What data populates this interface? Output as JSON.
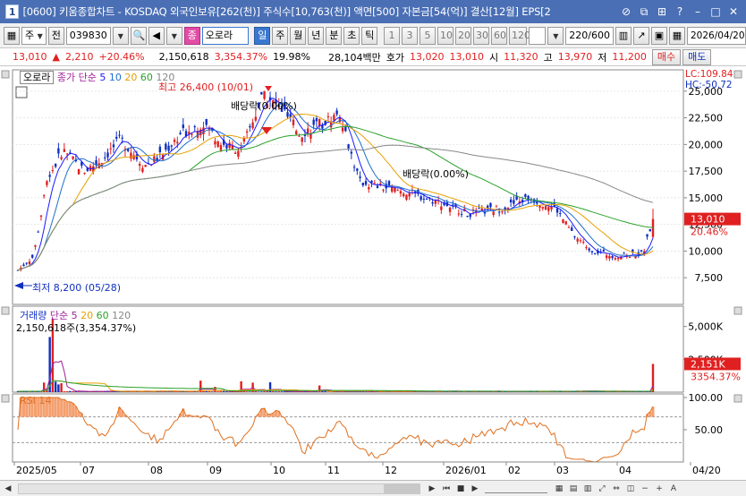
{
  "window": {
    "number": "1",
    "title": "[0600] 키움종합차트 - KOSDAQ 외국인보유[262(천)] 주식수[10,763(천)] 액면[500] 자본금[54(억)] 결산[12월] EPS[2"
  },
  "toolbar": {
    "type_select": "주",
    "scope": "전",
    "code": "039830",
    "search_icon": "magnifier-icon",
    "name_badge": "종",
    "stock_name": "오로라",
    "period_tabs": [
      "일",
      "주",
      "월",
      "년",
      "분",
      "초",
      "틱"
    ],
    "active_period": "일",
    "intervals": [
      "1",
      "3",
      "5",
      "10",
      "20",
      "30",
      "60",
      "120"
    ],
    "count": "220",
    "total": "/600",
    "date": "2026/04/20"
  },
  "quote": {
    "price": "13,010",
    "change": "2,210",
    "change_pct": "+20.46%",
    "volume": "2,150,618",
    "volume_pct": "3,354.37%",
    "turnover": "19.98%",
    "amount": "28,104백만",
    "bid_label": "호가",
    "ask": "13,020",
    "bid": "13,010",
    "open_label": "시",
    "open": "11,320",
    "high_label": "고",
    "high": "13,970",
    "low_label": "저",
    "low": "11,200",
    "buy_label": "매수",
    "sell_label": "매도"
  },
  "price_panel": {
    "stock_label": "오로라",
    "legend_title": "종가 단순",
    "ma_periods": [
      "5",
      "10",
      "20",
      "60",
      "120"
    ],
    "ma_colors": [
      "#1a1aff",
      "#1e6fcc",
      "#e8a000",
      "#2aa12a",
      "#888888"
    ],
    "lc": "LC:109.84",
    "hc": "HC:-50.72",
    "max_label": "최고 26,400 (10/01)",
    "min_label": "최저 8,200 (05/28)",
    "dividend1": "배당락(0.00%)",
    "dividend2": "배당락(0.00%)",
    "last_price": "13,010",
    "last_pct": "20.46%",
    "y_ticks": [
      "25,000",
      "22,500",
      "20,000",
      "17,500",
      "15,000",
      "12,500",
      "10,000",
      "7,500"
    ]
  },
  "volume_panel": {
    "title": "거래량",
    "legend_title": "단순",
    "ma_periods": [
      "5",
      "20",
      "60",
      "120"
    ],
    "value_text": "2,150,618주(3,354.37%)",
    "y_ticks": [
      "5,000K",
      "2,500K"
    ],
    "last_value": "2,151K",
    "last_pct": "3354.37%"
  },
  "rsi_panel": {
    "title": "RSI 14",
    "y_ticks": [
      "100.00",
      "50.00"
    ]
  },
  "x_axis": [
    "2025/05",
    "07",
    "08",
    "09",
    "10",
    "11",
    "12",
    "2026/01",
    "02",
    "03",
    "04",
    "04/20"
  ],
  "colors": {
    "up": "#e02020",
    "down": "#1030c0",
    "title_bg": "#4a6fb5",
    "rsi_line": "#e07020"
  },
  "chart_data": {
    "type": "candlestick",
    "price_range": [
      5000,
      27000
    ],
    "series_close_points": [
      [
        "2025-05-28",
        8200
      ],
      [
        "2025-06-05",
        9500
      ],
      [
        "2025-06-12",
        16500
      ],
      [
        "2025-06-20",
        19500
      ],
      [
        "2025-07-01",
        17500
      ],
      [
        "2025-07-10",
        18500
      ],
      [
        "2025-07-20",
        20500
      ],
      [
        "2025-08-01",
        18000
      ],
      [
        "2025-08-10",
        19000
      ],
      [
        "2025-08-20",
        21000
      ],
      [
        "2025-09-01",
        22000
      ],
      [
        "2025-09-10",
        20000
      ],
      [
        "2025-09-20",
        19500
      ],
      [
        "2025-10-01",
        24500
      ],
      [
        "2025-10-10",
        23500
      ],
      [
        "2025-10-20",
        21000
      ],
      [
        "2025-11-01",
        22000
      ],
      [
        "2025-11-10",
        23000
      ],
      [
        "2025-11-15",
        19500
      ],
      [
        "2025-11-20",
        16500
      ],
      [
        "2025-12-01",
        16000
      ],
      [
        "2025-12-15",
        15500
      ],
      [
        "2026-01-01",
        14500
      ],
      [
        "2026-01-15",
        13500
      ],
      [
        "2026-02-01",
        14000
      ],
      [
        "2026-02-15",
        15000
      ],
      [
        "2026-03-01",
        14000
      ],
      [
        "2026-03-10",
        11500
      ],
      [
        "2026-03-20",
        10000
      ],
      [
        "2026-04-01",
        9500
      ],
      [
        "2026-04-15",
        9800
      ],
      [
        "2026-04-20",
        13010
      ]
    ]
  }
}
